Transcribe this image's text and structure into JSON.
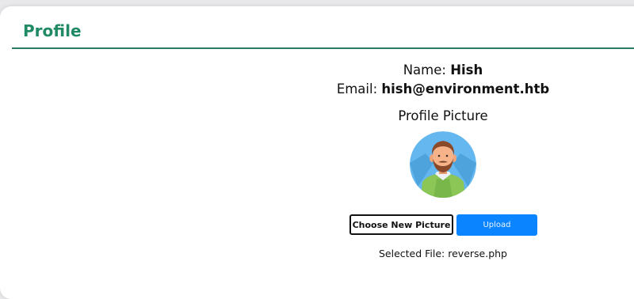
{
  "profile": {
    "title": "Profile",
    "name_label": "Name:",
    "name_value": "Hish",
    "email_label": "Email:",
    "email_value": "hish@environment.htb",
    "picture_heading": "Profile Picture",
    "choose_button_label": "Choose New Picture",
    "upload_button_label": "Upload",
    "selected_file_text": "Selected File: reverse.php"
  },
  "colors": {
    "accent": "#1f8a64",
    "divider": "#2b7a66",
    "upload_button": "#0a84ff"
  },
  "icons": {
    "avatar": "user-avatar-bearded-man"
  }
}
